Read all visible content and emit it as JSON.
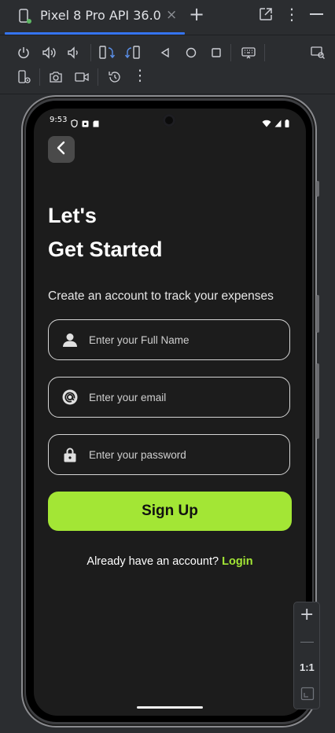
{
  "window": {
    "tab_title": "Pixel 8 Pro API 36.0",
    "tab_close": "×",
    "new_tab": "+",
    "more": "⋮"
  },
  "toolbar": {
    "icons": [
      "power-icon",
      "volume-up-icon",
      "volume-down-icon",
      "rotate-left-icon",
      "rotate-right-icon",
      "back-icon",
      "home-icon",
      "overview-icon",
      "keyboard-icon",
      "display-mode-icon",
      "extended-controls-icon",
      "screenshot-icon",
      "screen-record-icon",
      "snapshot-icon",
      "more-icon"
    ],
    "more": "⋮"
  },
  "device": {
    "status_bar": {
      "time": "9:53"
    },
    "app": {
      "headline_line1": "Let's",
      "headline_line2": "Get Started",
      "subtitle": "Create an account to track your expenses",
      "fields": [
        {
          "icon": "person-icon",
          "placeholder": "Enter your Full Name"
        },
        {
          "icon": "at-sign-icon",
          "placeholder": "Enter your email"
        },
        {
          "icon": "lock-icon",
          "placeholder": "Enter your password"
        }
      ],
      "signup_label": "Sign Up",
      "login_prompt": "Already have an account?",
      "login_link": "Login",
      "colors": {
        "accent": "#a3e635",
        "background": "#1c1c1c",
        "back_button": "#4a4a4a"
      }
    }
  },
  "zoom": {
    "plus": "+",
    "fit": "1:1"
  },
  "colors": {
    "ide_background": "#2b2d30",
    "tab_indicator": "#3574f0"
  }
}
